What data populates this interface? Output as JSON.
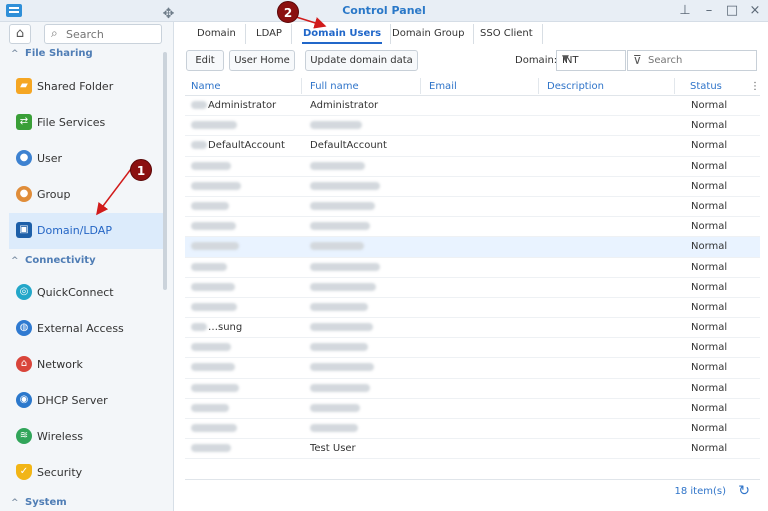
{
  "window": {
    "title": "Control Panel",
    "pin_icon": "pin-icon",
    "minimize_icon": "minimize-icon",
    "maximize_icon": "maximize-icon",
    "close_icon": "close-icon"
  },
  "sidebar": {
    "search_placeholder": "Search",
    "sections": [
      {
        "label": "File Sharing"
      },
      {
        "label": "Connectivity"
      },
      {
        "label": "System"
      }
    ],
    "items": [
      {
        "label": "Shared Folder",
        "icon": "shared-folder-icon"
      },
      {
        "label": "File Services",
        "icon": "file-services-icon"
      },
      {
        "label": "User",
        "icon": "user-icon"
      },
      {
        "label": "Group",
        "icon": "group-icon"
      },
      {
        "label": "Domain/LDAP",
        "icon": "domain-ldap-icon"
      },
      {
        "label": "QuickConnect",
        "icon": "quickconnect-icon"
      },
      {
        "label": "External Access",
        "icon": "external-access-icon"
      },
      {
        "label": "Network",
        "icon": "network-icon"
      },
      {
        "label": "DHCP Server",
        "icon": "dhcp-server-icon"
      },
      {
        "label": "Wireless",
        "icon": "wireless-icon"
      },
      {
        "label": "Security",
        "icon": "security-icon"
      }
    ]
  },
  "tabs": [
    "Domain",
    "LDAP",
    "Domain Users",
    "Domain Group",
    "SSO Client"
  ],
  "toolbar": {
    "edit_label": "Edit",
    "user_home_label": "User Home",
    "update_label": "Update domain data",
    "domain_label": "Domain:",
    "domain_value": "INT",
    "search_placeholder": "Search"
  },
  "table": {
    "columns": [
      "Name",
      "Full name",
      "Email",
      "Description",
      "Status"
    ],
    "rows": [
      {
        "name": "Administrator",
        "full_name": "Administrator",
        "status": "Normal"
      },
      {
        "name": "",
        "full_name": "",
        "status": "Normal"
      },
      {
        "name": "DefaultAccount",
        "full_name": "DefaultAccount",
        "status": "Normal"
      },
      {
        "name": "",
        "full_name": "",
        "status": "Normal"
      },
      {
        "name": "",
        "full_name": "",
        "status": "Normal"
      },
      {
        "name": "",
        "full_name": "",
        "status": "Normal"
      },
      {
        "name": "",
        "full_name": "",
        "status": "Normal"
      },
      {
        "name": "",
        "full_name": "",
        "status": "Normal"
      },
      {
        "name": "",
        "full_name": "",
        "status": "Normal"
      },
      {
        "name": "",
        "full_name": "",
        "status": "Normal"
      },
      {
        "name": "",
        "full_name": "",
        "status": "Normal"
      },
      {
        "name": "…sung",
        "full_name": "",
        "status": "Normal"
      },
      {
        "name": "",
        "full_name": "",
        "status": "Normal"
      },
      {
        "name": "",
        "full_name": "",
        "status": "Normal"
      },
      {
        "name": "",
        "full_name": "",
        "status": "Normal"
      },
      {
        "name": "",
        "full_name": "",
        "status": "Normal"
      },
      {
        "name": "",
        "full_name": "",
        "status": "Normal"
      },
      {
        "name": "",
        "full_name": "Test User",
        "status": "Normal"
      }
    ]
  },
  "footer": {
    "count": "18 item(s)"
  },
  "annotations": [
    {
      "number": "1"
    },
    {
      "number": "2"
    }
  ],
  "colors": {
    "accent": "#2167c9",
    "marker": "#8b1010",
    "selected_row": "#e9f3ff",
    "sidebar_active": "#dcebfb"
  }
}
